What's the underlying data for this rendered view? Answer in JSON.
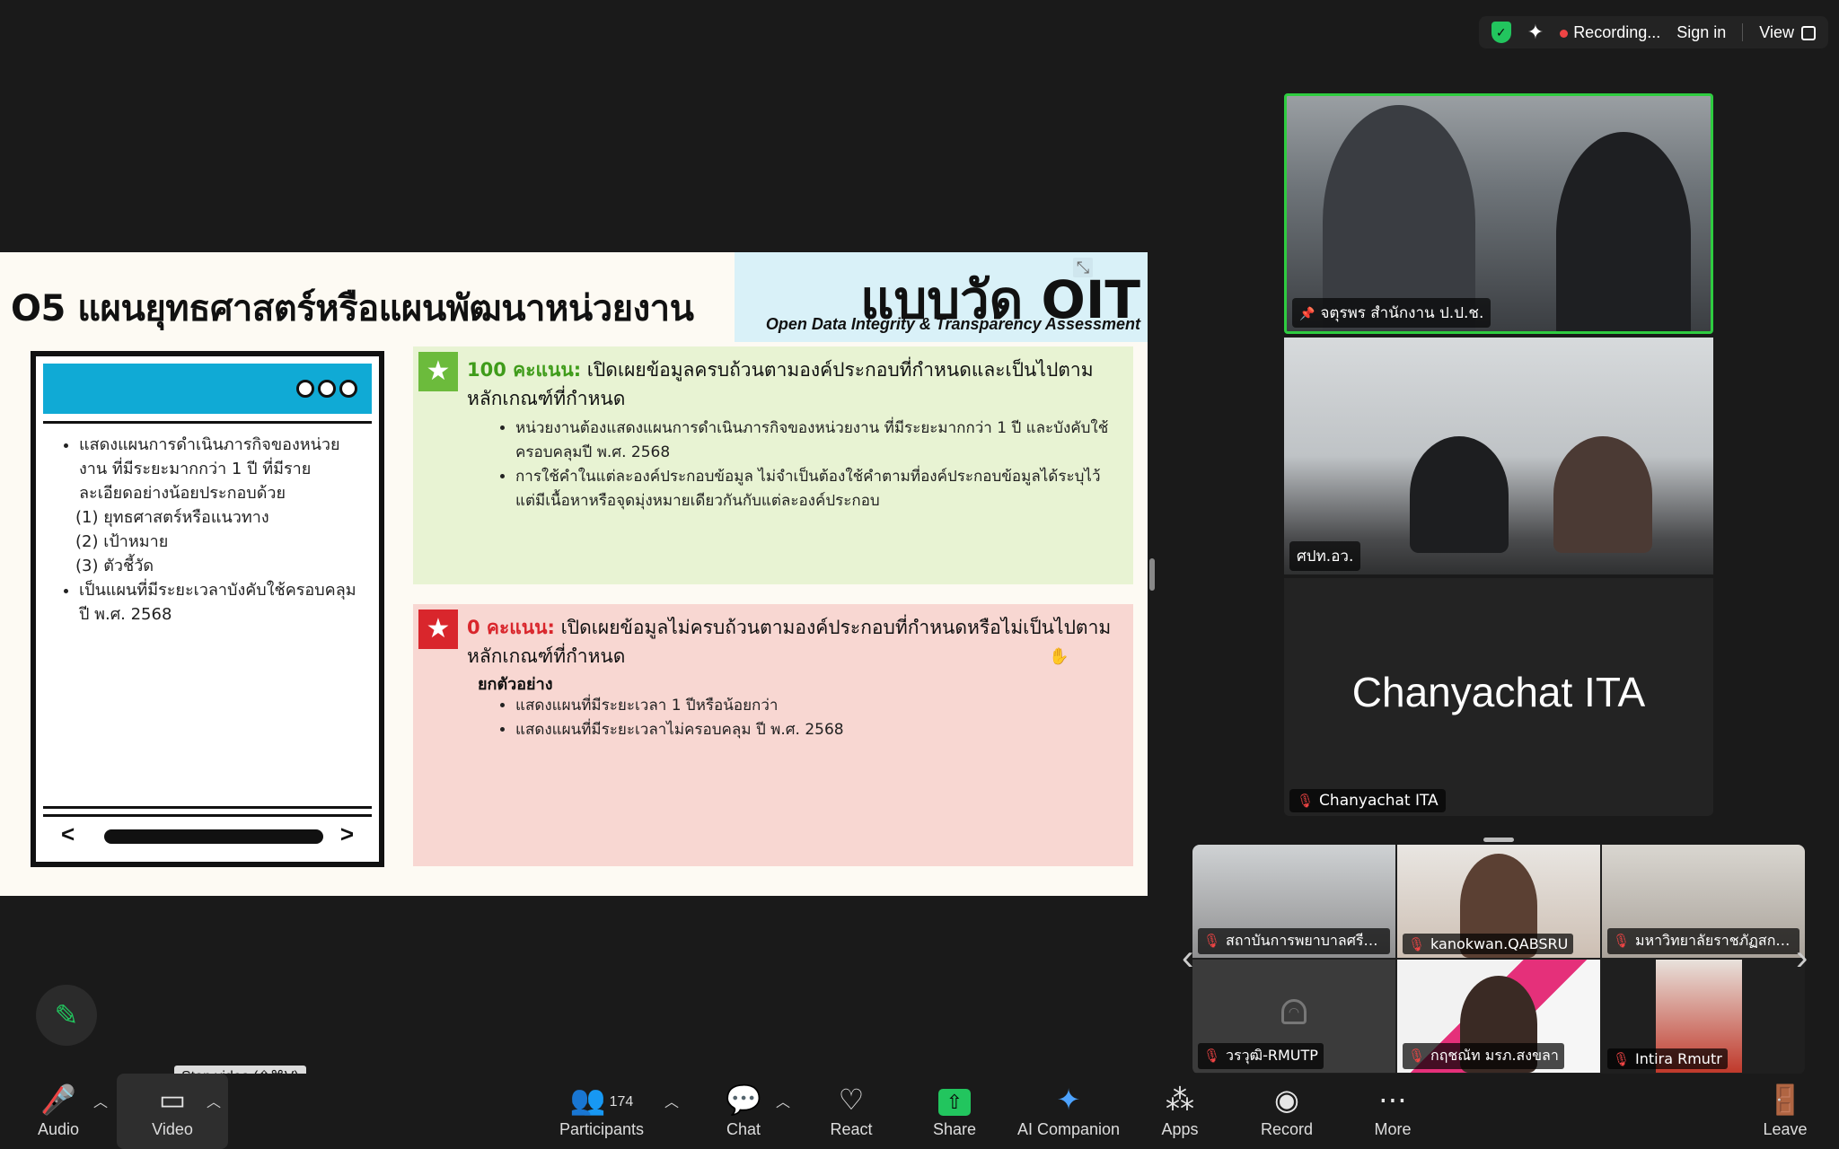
{
  "topbar": {
    "recording_label": "Recording...",
    "sign_in_label": "Sign in",
    "view_label": "View"
  },
  "slide": {
    "title": "O5 แผนยุทธศาสตร์หรือแผนพัฒนาหน่วยงาน",
    "badge_title": "แบบวัด OIT",
    "badge_subtitle": "Open Data Integrity & Transparency Assessment",
    "left_card": {
      "items": [
        "แสดงแผนการดำเนินภารกิจของหน่วยงาน ที่มีระยะมากกว่า 1 ปี ที่มีรายละเอียดอย่างน้อยประกอบด้วย",
        "เป็นแผนที่มีระยะเวลาบังคับใช้ครอบคลุมปี พ.ศ. 2568"
      ],
      "sub_items": [
        "(1) ยุทธศาสตร์หรือแนวทาง",
        "(2) เป้าหมาย",
        "(3) ตัวชี้วัด"
      ]
    },
    "green_panel": {
      "score": "100 คะแนน:",
      "heading": " เปิดเผยข้อมูลครบถ้วนตามองค์ประกอบที่กำหนดและเป็นไปตามหลักเกณฑ์ที่กำหนด",
      "bullets": [
        "หน่วยงานต้องแสดงแผนการดำเนินภารกิจของหน่วยงาน ที่มีระยะมากกว่า 1 ปี และบังคับใช้ครอบคลุมปี พ.ศ. 2568",
        "การใช้คำในแต่ละองค์ประกอบข้อมูล ไม่จำเป็นต้องใช้คำตามที่องค์ประกอบข้อมูลได้ระบุไว้ แต่มีเนื้อหาหรือจุดมุ่งหมายเดียวกันกับแต่ละองค์ประกอบ"
      ]
    },
    "red_panel": {
      "score": "0 คะแนน:",
      "heading": " เปิดเผยข้อมูลไม่ครบถ้วนตามองค์ประกอบที่กำหนดหรือไม่เป็นไปตามหลักเกณฑ์ที่กำหนด",
      "example_label": "ยกตัวอย่าง",
      "bullets": [
        "แสดงแผนที่มีระยะเวลา 1 ปีหรือน้อยกว่า",
        "แสดงแผนที่มีระยะเวลาไม่ครอบคลุม ปี พ.ศ. 2568"
      ]
    }
  },
  "tiles": {
    "speaker_1": "จตุรพร สำนักงาน ป.ป.ช.",
    "speaker_2": "ศปท.อว.",
    "speaker_3_big": "Chanyachat ITA",
    "speaker_3_label": "Chanyachat ITA"
  },
  "gallery": [
    "สถาบันการพยาบาลศรีส...",
    "kanokwan.QABSRU",
    "มหาวิทยาลัยราชภัฏสกล...",
    "วรวุฒิ-RMUTP",
    "กฤชณัท มรภ.สงขลา",
    "Intira Rmutr"
  ],
  "tooltip": "Stop video (⇧⌘V)",
  "toolbar": {
    "audio": "Audio",
    "video": "Video",
    "participants": "Participants",
    "participants_count": "174",
    "chat": "Chat",
    "react": "React",
    "share": "Share",
    "ai_companion": "AI Companion",
    "apps": "Apps",
    "record": "Record",
    "more": "More",
    "leave": "Leave"
  },
  "colors": {
    "accent_green": "#22c55e",
    "slide_header_blue": "#10aad5",
    "panel_green": "#e8f3d3",
    "panel_red": "#f8d7d2",
    "mute_red": "#ef4444"
  }
}
